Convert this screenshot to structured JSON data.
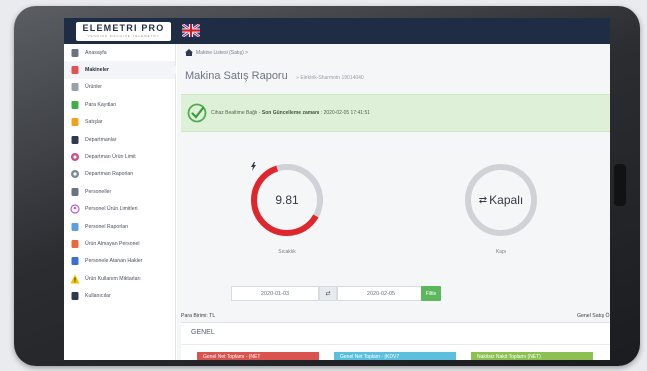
{
  "app": {
    "logo_name": "ELEMETRI PRO",
    "logo_tagline": "VENDING MACHINE TELEMETRY"
  },
  "sidebar": {
    "items": [
      {
        "label": "Anasayfa",
        "icon": "home-icon",
        "active": false
      },
      {
        "label": "Makineler",
        "icon": "machines-icon",
        "active": true
      },
      {
        "label": "Ürünler",
        "icon": "products-icon",
        "active": false
      },
      {
        "label": "Para Kayıtları",
        "icon": "money-icon",
        "active": false
      },
      {
        "label": "Satışlar",
        "icon": "sales-icon",
        "active": false
      },
      {
        "label": "Departmanlar",
        "icon": "departments-icon",
        "active": false
      },
      {
        "label": "Departman Ürün Limit",
        "icon": "department-limit-icon",
        "active": false
      },
      {
        "label": "Departman Raporları",
        "icon": "department-reports-icon",
        "active": false
      },
      {
        "label": "Personeller",
        "icon": "personnel-icon",
        "active": false
      },
      {
        "label": "Personel Ürün Limitleri",
        "icon": "personnel-limit-icon",
        "active": false
      },
      {
        "label": "Personel Raporları",
        "icon": "personnel-reports-icon",
        "active": false
      },
      {
        "label": "Ürün Almayan Personel",
        "icon": "non-buying-icon",
        "active": false
      },
      {
        "label": "Personele Atanan Hakler",
        "icon": "assigned-rights-icon",
        "active": false
      },
      {
        "label": "Ürün Kullanım Miktarları",
        "icon": "warning-icon",
        "active": false
      },
      {
        "label": "Kullanıcılar",
        "icon": "users-icon",
        "active": false
      }
    ]
  },
  "breadcrumb": {
    "text": "Makine Listesi (Satış) >"
  },
  "header": {
    "title": "Makina Satış Raporu",
    "subtitle": "» Elektrik-Sharmotn 19014040"
  },
  "alert": {
    "status": "Cihaz Bealtime Bağlı",
    "separator": " - ",
    "update_label": "Son Güncelleme zamanı",
    "update_value": " : 2020-02-05 17:41:51"
  },
  "gauges": {
    "temperature": {
      "value": "9.81",
      "label": "Sıcaklık",
      "fill": 0.62,
      "color": "#e0262a"
    },
    "door": {
      "value": "Kapalı",
      "label": "Kapı",
      "fill": 0,
      "color": "#cccccc"
    }
  },
  "filter": {
    "start_date": "2020-01-03",
    "separator": "⇄",
    "end_date": "2020-02-05",
    "button": "Filtle"
  },
  "summary": {
    "currency_label": "Para Birimi: TL",
    "right_label": "Genel Satış Ö"
  },
  "panel": {
    "title": "GENEL",
    "stats": [
      {
        "label": "Genel Net Toplamı - (NET",
        "color": "#d9534f"
      },
      {
        "label": "Genel Net Toplam - (KDV7",
        "color": "#5bc0de"
      },
      {
        "label": "Nakitsiz Nakit Toplamı (NET)",
        "color": "#8cc152"
      }
    ]
  },
  "colors": {
    "topbar": "#1f2d44",
    "success_bg": "#dff0d8",
    "success": "#4cae4c"
  }
}
